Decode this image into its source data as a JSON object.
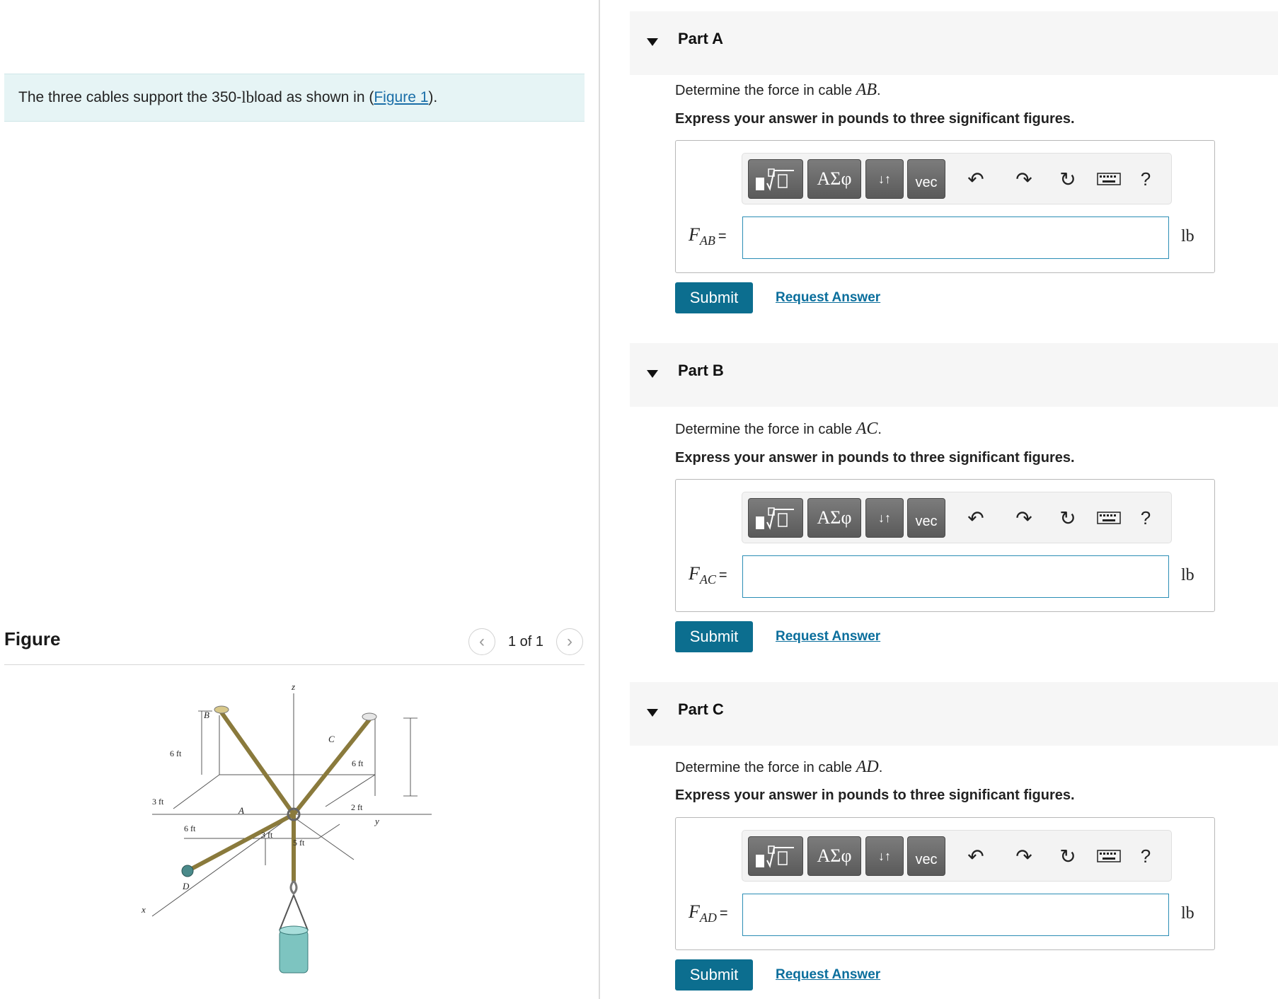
{
  "problem": {
    "intro_text": "The three cables support the 350-",
    "intro_load_unit": "lb",
    "intro_tail": " load as shown in (",
    "figure_link": "Figure 1",
    "intro_end": ")."
  },
  "figure": {
    "title": "Figure",
    "pager": "1 of 1",
    "prev_icon": "chevron-left-icon",
    "next_icon": "chevron-right-icon",
    "labels": {
      "z": "z",
      "x": "x",
      "y": "y",
      "B": "B",
      "C": "C",
      "A": "A",
      "D": "D",
      "dim_6ft_left": "6 ft",
      "dim_6ft_right": "6 ft",
      "dim_3ft_left": "3 ft",
      "dim_2ft": "2 ft",
      "dim_6ft_bottom": "6 ft",
      "dim_3ft_mid": "3 ft",
      "dim_5ft": "5 ft"
    }
  },
  "parts": [
    {
      "title": "Part A",
      "question_prefix": "Determine the force in cable ",
      "cable": "AB",
      "question_suffix": ".",
      "instruction": "Express your answer in pounds to three significant figures.",
      "var_main": "F",
      "var_sub": "AB",
      "var_eq": "=",
      "unit": "lb",
      "input_value": "",
      "submit": "Submit",
      "request": "Request Answer"
    },
    {
      "title": "Part B",
      "question_prefix": "Determine the force in cable ",
      "cable": "AC",
      "question_suffix": ".",
      "instruction": "Express your answer in pounds to three significant figures.",
      "var_main": "F",
      "var_sub": "AC",
      "var_eq": "=",
      "unit": "lb",
      "input_value": "",
      "submit": "Submit",
      "request": "Request Answer"
    },
    {
      "title": "Part C",
      "question_prefix": "Determine the force in cable ",
      "cable": "AD",
      "question_suffix": ".",
      "instruction": "Express your answer in pounds to three significant figures.",
      "var_main": "F",
      "var_sub": "AD",
      "var_eq": "=",
      "unit": "lb",
      "input_value": "",
      "submit": "Submit",
      "request": "Request Answer"
    }
  ],
  "toolbar": {
    "greek_label": "ΑΣφ",
    "arrows_label": "↓↑",
    "vec_label": "vec",
    "help_label": "?",
    "icons": [
      "templates-icon",
      "undo-icon",
      "redo-icon",
      "reset-icon",
      "keyboard-icon",
      "help-icon"
    ]
  },
  "colors": {
    "accent": "#0c6e8f",
    "link": "#0a6e9c",
    "intro_bg": "#e6f4f5",
    "part_header_bg": "#f6f6f6",
    "input_border": "#2b8db5"
  }
}
